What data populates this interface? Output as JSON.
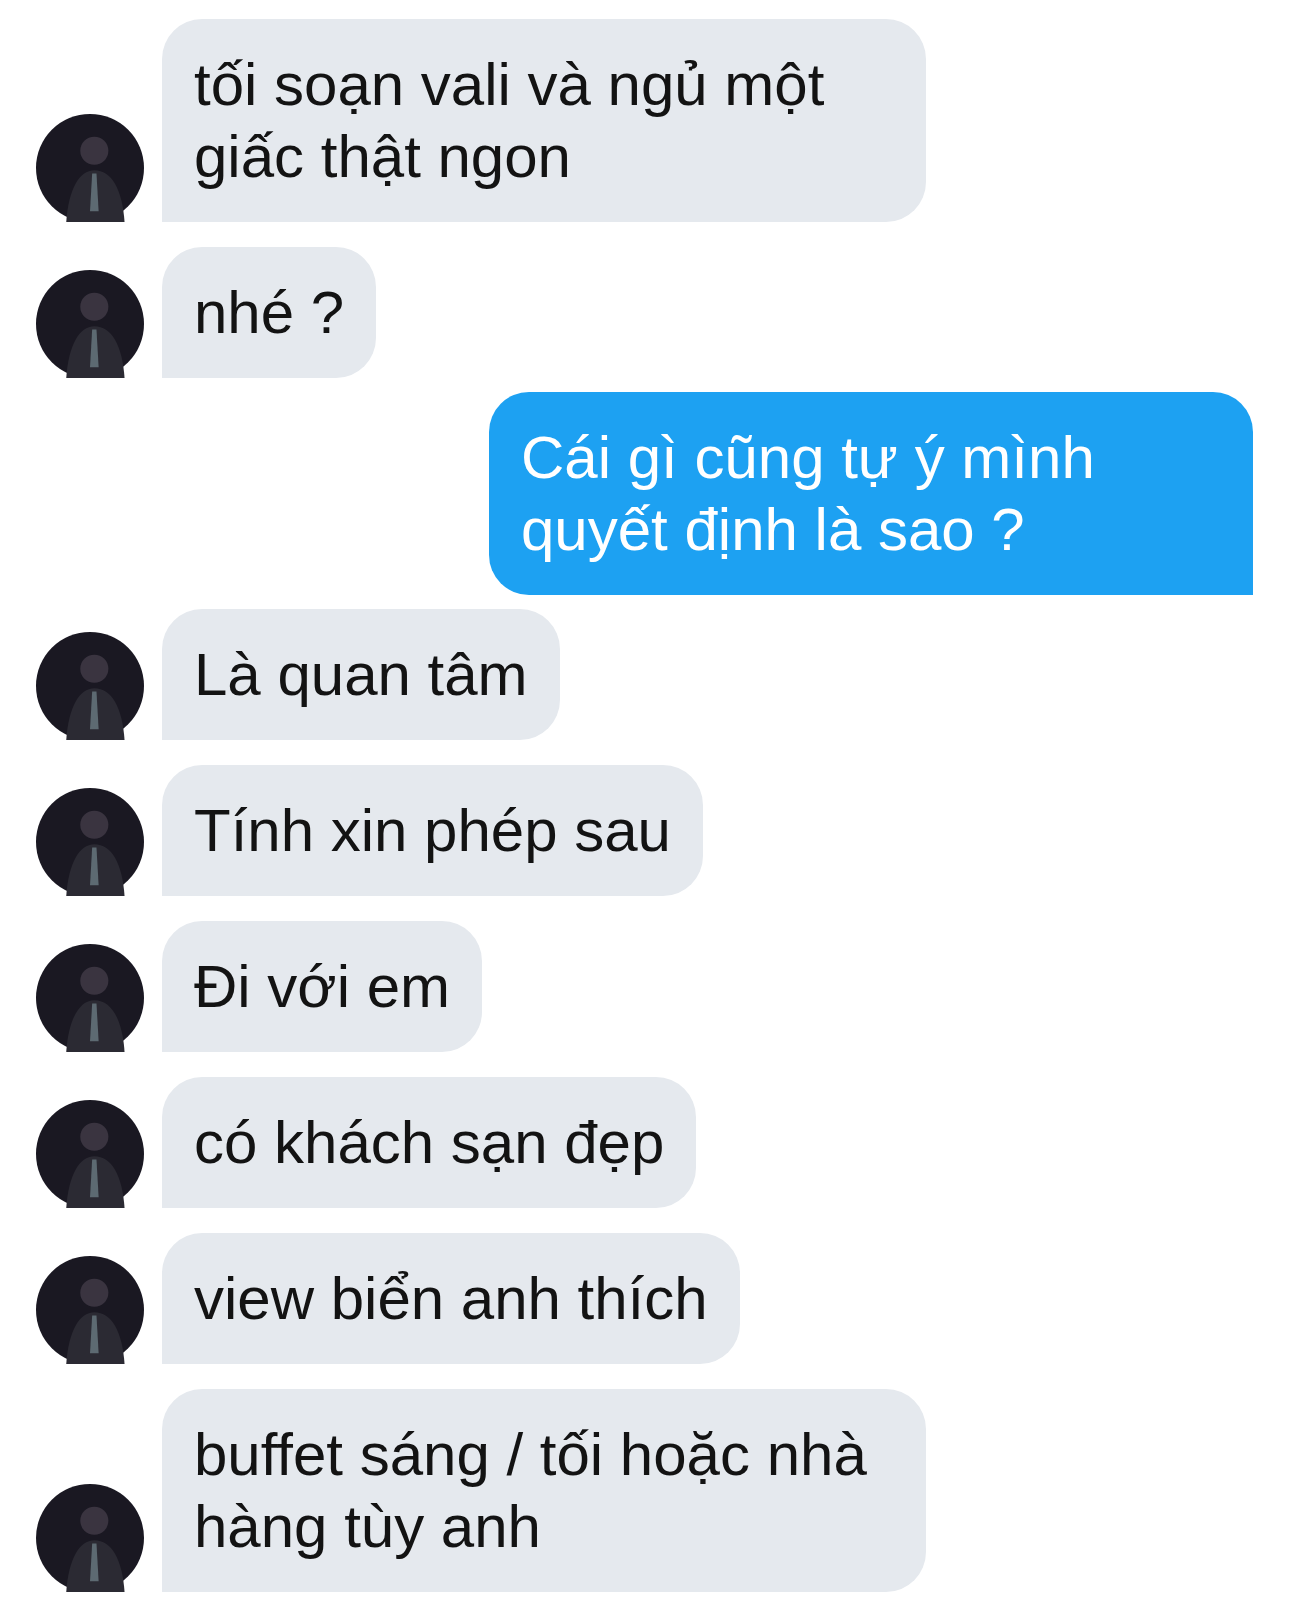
{
  "messages": [
    {
      "kind": "received",
      "text": "tối soạn vali và ngủ một giấc thật ngon"
    },
    {
      "kind": "received",
      "text": "nhé ?"
    },
    {
      "kind": "sent",
      "text": "Cái gì cũng tự ý mình quyết định là sao ?"
    },
    {
      "kind": "received",
      "text": "Là quan tâm"
    },
    {
      "kind": "received",
      "text": "Tính xin phép sau"
    },
    {
      "kind": "received",
      "text": "Đi với em"
    },
    {
      "kind": "received",
      "text": "có khách sạn đẹp"
    },
    {
      "kind": "received",
      "text": "view biển anh thích"
    },
    {
      "kind": "received",
      "text": "buffet sáng / tối hoặc nhà hàng tùy anh"
    }
  ]
}
